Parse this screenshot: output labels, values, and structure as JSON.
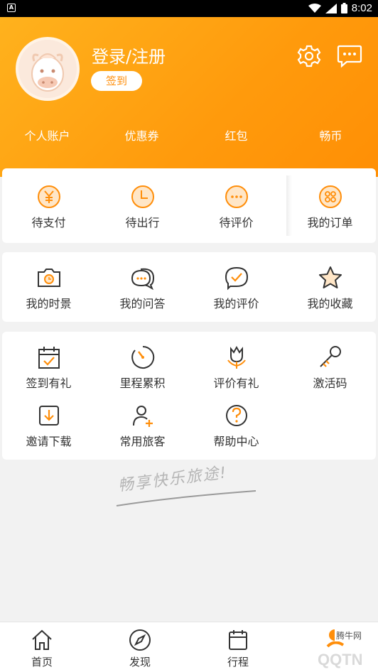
{
  "status_bar": {
    "time": "8:02"
  },
  "header": {
    "login_label": "登录/注册",
    "signin_label": "签到",
    "accounts": [
      "个人账户",
      "优惠券",
      "红包",
      "畅币"
    ]
  },
  "orders": [
    {
      "label": "待支付"
    },
    {
      "label": "待出行"
    },
    {
      "label": "待评价"
    },
    {
      "label": "我的订单"
    }
  ],
  "mine": [
    {
      "label": "我的时景"
    },
    {
      "label": "我的问答"
    },
    {
      "label": "我的评价"
    },
    {
      "label": "我的收藏"
    }
  ],
  "services": [
    {
      "label": "签到有礼"
    },
    {
      "label": "里程累积"
    },
    {
      "label": "评价有礼"
    },
    {
      "label": "激活码"
    },
    {
      "label": "邀请下载"
    },
    {
      "label": "常用旅客"
    },
    {
      "label": "帮助中心"
    }
  ],
  "slogan": "畅享快乐旅途!",
  "tabbar": [
    {
      "label": "首页"
    },
    {
      "label": "发现"
    },
    {
      "label": "行程"
    }
  ],
  "watermark": {
    "text": "腾牛网"
  },
  "colors": {
    "accent": "#ff9a0c",
    "icon_stroke": "#333333",
    "icon_accent": "#ff8e0a"
  }
}
